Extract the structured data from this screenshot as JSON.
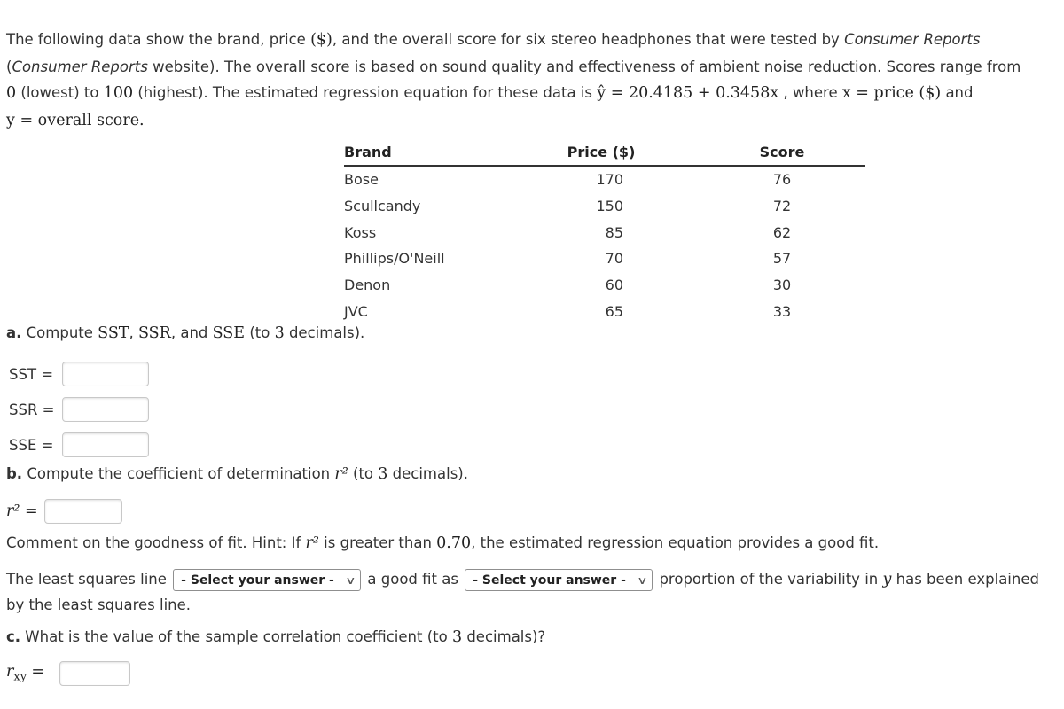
{
  "intro": {
    "s1_a": "The following data show the brand, price ",
    "s1_dollar": "($)",
    "s1_b": ", and the overall score for six stereo headphones that were tested by ",
    "s1_source": "Consumer Reports",
    "s2_a": "(",
    "s2_source": "Consumer Reports",
    "s2_b": " website). The overall score is based on sound quality and effectiveness of ambient noise reduction. Scores range from",
    "s3_low": "0",
    "s3_a": " (lowest) to ",
    "s3_high": "100",
    "s3_b": " (highest). The estimated regression equation for these data is ",
    "equation": "ŷ = 20.4185 + 0.3458x",
    "s3_c": " , where ",
    "x_def": "x = price ($)",
    "s3_d": " and",
    "y_def": "y = overall score."
  },
  "table": {
    "headers": [
      "Brand",
      "Price ($)",
      "Score"
    ],
    "rows": [
      {
        "brand": "Bose",
        "price": "170",
        "score": "76"
      },
      {
        "brand": "Scullcandy",
        "price": "150",
        "score": "72"
      },
      {
        "brand": "Koss",
        "price": "85",
        "score": "62"
      },
      {
        "brand": "Phillips/O'Neill",
        "price": "70",
        "score": "57"
      },
      {
        "brand": "Denon",
        "price": "60",
        "score": "30"
      },
      {
        "brand": "JVC",
        "price": "65",
        "score": "33"
      }
    ]
  },
  "part_a": {
    "label": "a.",
    "text_a": " Compute ",
    "m1": "SST",
    "sep1": ", ",
    "m2": "SSR",
    "sep2": ", and ",
    "m3": "SSE",
    "text_b": " (to ",
    "digits": "3",
    "text_c": " decimals).",
    "fields": [
      {
        "label": "SST =",
        "value": ""
      },
      {
        "label": "SSR =",
        "value": ""
      },
      {
        "label": "SSE =",
        "value": ""
      }
    ]
  },
  "part_b": {
    "label": "b.",
    "text_a": " Compute the coefficient of determination ",
    "sym": "r²",
    "text_b": " (to ",
    "digits": "3",
    "text_c": " decimals).",
    "field_label": "r² =",
    "field_value": "",
    "comment_a": "Comment on the goodness of fit. Hint: If ",
    "comment_sym": "r²",
    "comment_b": " is greater than ",
    "comment_num": "0.70",
    "comment_c": ", the estimated regression equation provides a good fit.",
    "sentence_a": "The least squares line ",
    "select1": "- Select your answer -",
    "sentence_b": " a good fit as ",
    "select2": "- Select your answer -",
    "sentence_c": " proportion of the variability in ",
    "sentence_y": "y",
    "sentence_d": " has been explained",
    "sentence_e": "by the least squares line."
  },
  "part_c": {
    "label": "c.",
    "text_a": " What is the value of the sample correlation coefficient (to ",
    "digits": "3",
    "text_b": " decimals)?",
    "field_label": "r",
    "field_sub": "xy",
    "field_eq": "=",
    "field_value": ""
  }
}
